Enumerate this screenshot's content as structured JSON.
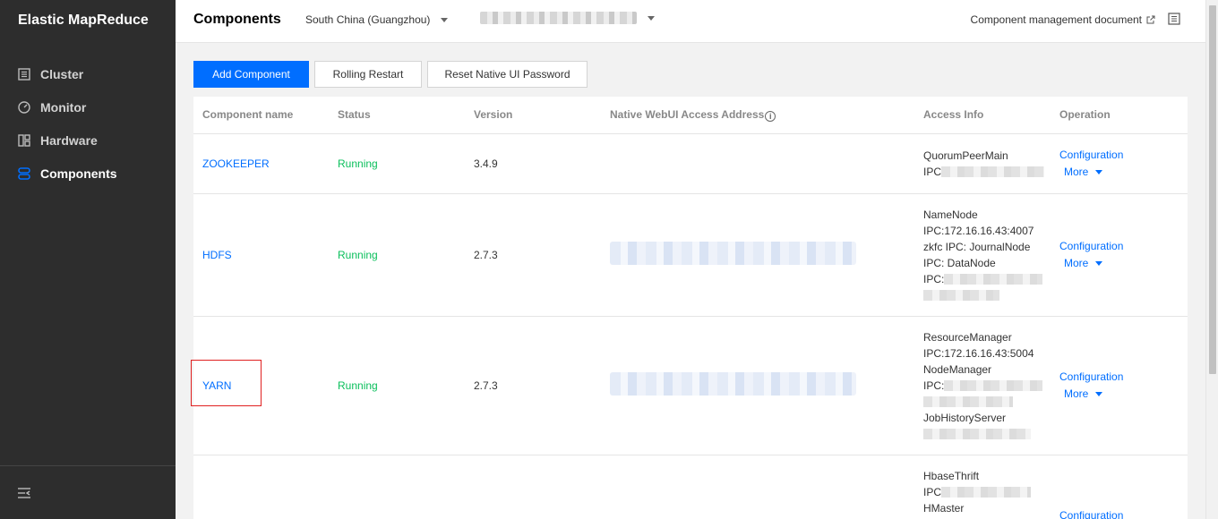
{
  "sidebar": {
    "brand": "Elastic MapReduce",
    "items": [
      {
        "label": "Cluster",
        "icon": "cluster-icon"
      },
      {
        "label": "Monitor",
        "icon": "monitor-icon"
      },
      {
        "label": "Hardware",
        "icon": "hardware-icon"
      },
      {
        "label": "Components",
        "icon": "components-icon",
        "active": true
      }
    ]
  },
  "header": {
    "title": "Components",
    "region": "South China (Guangzhou)",
    "doc_link": "Component management document"
  },
  "toolbar": {
    "add": "Add Component",
    "restart": "Rolling Restart",
    "reset": "Reset Native UI Password"
  },
  "table": {
    "columns": [
      "Component name",
      "Status",
      "Version",
      "Native WebUI Access Address",
      "Access Info",
      "Operation"
    ],
    "info_icon": "i",
    "rows": [
      {
        "name": "ZOOKEEPER",
        "status": "Running",
        "version": "3.4.9",
        "access": [
          "QuorumPeerMain",
          "IPC"
        ],
        "config": "Configuration",
        "more": "More"
      },
      {
        "name": "HDFS",
        "status": "Running",
        "version": "2.7.3",
        "access": [
          "NameNode",
          "IPC:172.16.16.43:4007",
          "zkfc IPC: JournalNode",
          "IPC: DataNode",
          "IPC:"
        ],
        "config": "Configuration",
        "more": "More"
      },
      {
        "name": "YARN",
        "status": "Running",
        "version": "2.7.3",
        "access": [
          "ResourceManager",
          "IPC:172.16.16.43:5004",
          "NodeManager",
          "IPC:",
          "",
          "JobHistoryServer"
        ],
        "config": "Configuration",
        "more": "More"
      },
      {
        "name": "",
        "status": "",
        "version": "",
        "access": [
          "HbaseThrift",
          "IPC",
          "HMaster"
        ],
        "config": "Configuration",
        "more": ""
      }
    ]
  },
  "colors": {
    "primary": "#006eff",
    "running": "#0abf5b",
    "sidebar": "#2d2d2d",
    "highlight": "#e02020"
  }
}
